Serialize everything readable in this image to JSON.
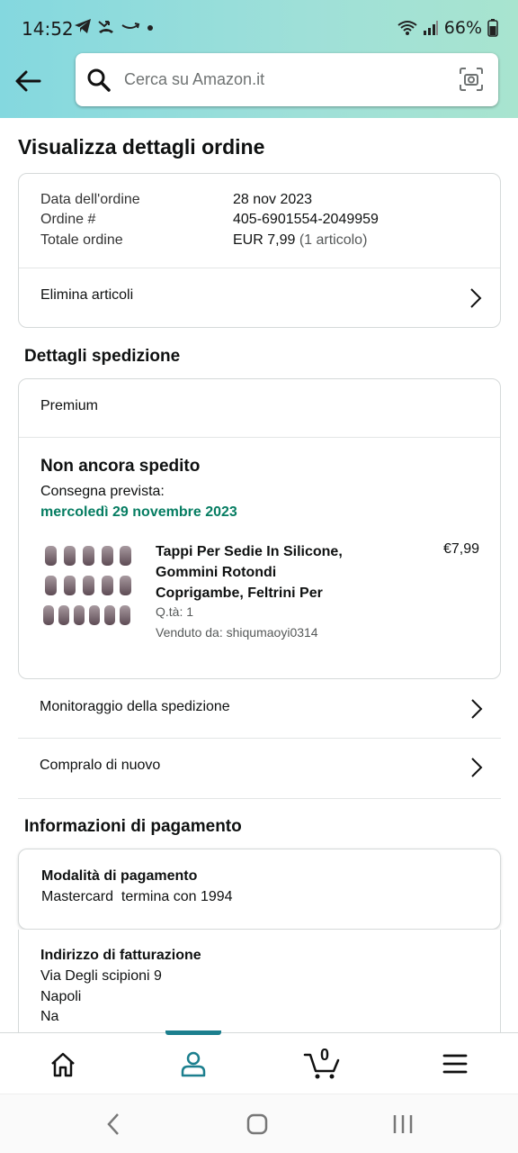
{
  "status_bar": {
    "time": "14:52",
    "battery": "66%"
  },
  "search": {
    "placeholder": "Cerca su Amazon.it"
  },
  "page": {
    "title": "Visualizza dettagli ordine"
  },
  "order_summary": {
    "date_label": "Data dell'ordine",
    "date_value": "28 nov 2023",
    "order_label": "Ordine #",
    "order_value": "405-6901554-2049959",
    "total_label": "Totale ordine",
    "total_value": "EUR 7,99",
    "total_items": "(1 articolo)",
    "delete_items": "Elimina articoli"
  },
  "shipping": {
    "section_title": "Dettagli spedizione",
    "tier": "Premium",
    "status": "Non ancora spedito",
    "delivery_label": "Consegna prevista:",
    "delivery_date": "mercoledì 29 novembre 2023",
    "product": {
      "title_line1": "Tappi Per Sedie In Silicone,",
      "title_line2": "Gommini Rotondi",
      "title_line3": "Coprigambe, Feltrini Per",
      "qty": "Q.tà: 1",
      "seller": "Venduto da: shiqumaoyi0314",
      "price": "€7,99"
    },
    "track_label": "Monitoraggio della spedizione",
    "buy_again_label": "Compralo di nuovo"
  },
  "payment": {
    "section_title": "Informazioni di pagamento",
    "method_title": "Modalità di pagamento",
    "method_value": "Mastercard  termina con 1994",
    "billing_title": "Indirizzo di fatturazione",
    "billing_line1": "Via Degli scipioni 9",
    "billing_line2": "Napoli",
    "billing_line3": "Na"
  },
  "bottom_nav": {
    "cart_count": "0"
  },
  "colors": {
    "accent": "#1c7f8e",
    "delivery_green": "#067d62",
    "header_gradient": "#84d8df"
  }
}
